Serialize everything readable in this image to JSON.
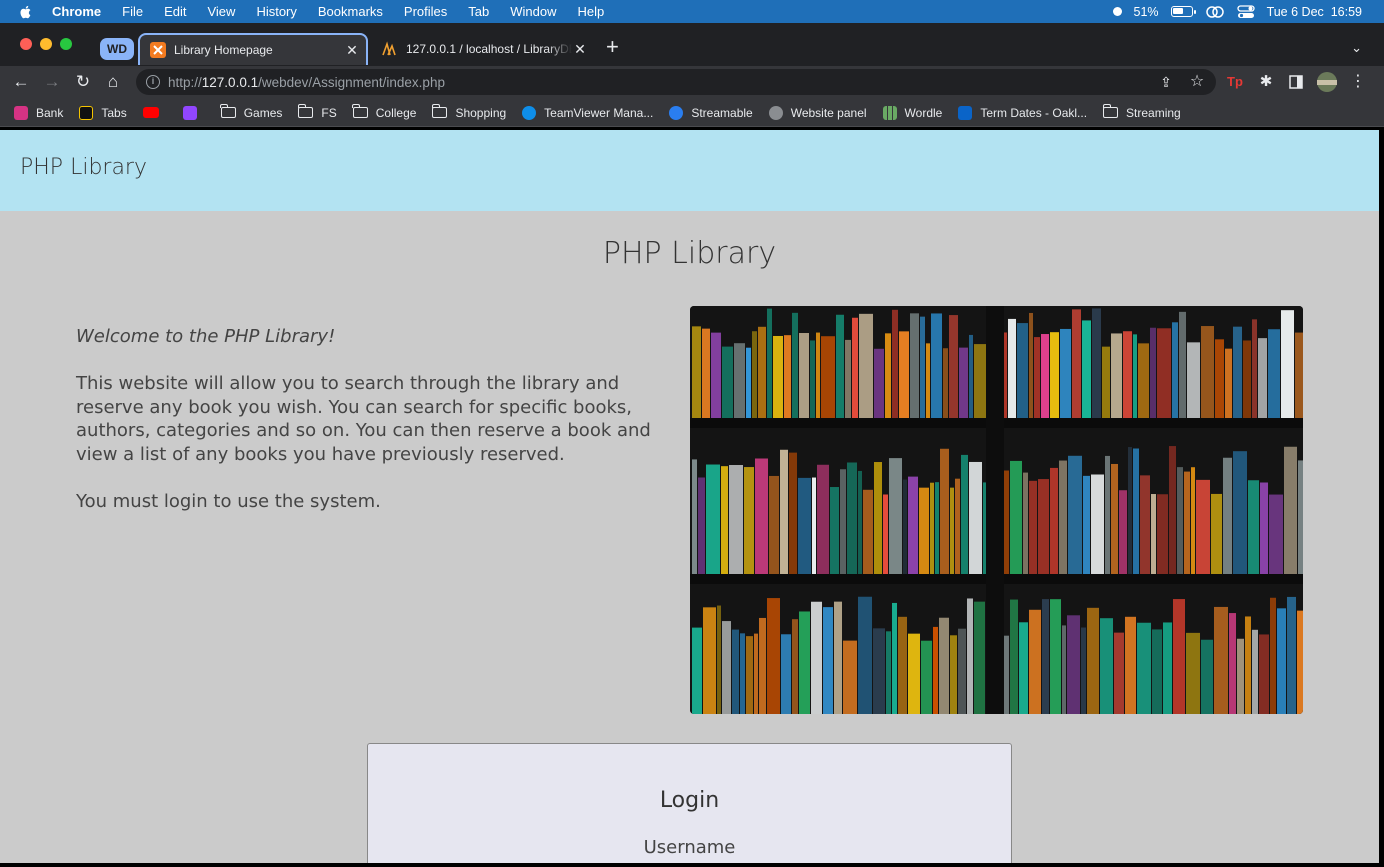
{
  "menubar": {
    "app": "Chrome",
    "items": [
      "File",
      "Edit",
      "View",
      "History",
      "Bookmarks",
      "Profiles",
      "Tab",
      "Window",
      "Help"
    ],
    "battery": "51%",
    "clock": "Tue 6 Dec  16:59"
  },
  "browser": {
    "group_chip": "WD",
    "tabs": [
      {
        "title": "Library Homepage",
        "active": true,
        "favicon": "xampp-icon"
      },
      {
        "title": "127.0.0.1 / localhost / LibraryDB",
        "active": false,
        "favicon": "phpmyadmin-icon"
      }
    ],
    "url_prefix": "http://",
    "url_host": "127.0.0.1",
    "url_path": "/webdev/Assignment/index.php"
  },
  "bookmarks": [
    {
      "label": "Bank",
      "icon": "bank-icon"
    },
    {
      "label": "Tabs",
      "icon": "g-icon"
    },
    {
      "label": "",
      "icon": "youtube-icon"
    },
    {
      "label": "",
      "icon": "twitch-icon"
    },
    {
      "label": "Games",
      "icon": "folder-icon"
    },
    {
      "label": "FS",
      "icon": "folder-icon"
    },
    {
      "label": "College",
      "icon": "folder-icon"
    },
    {
      "label": "Shopping",
      "icon": "folder-icon"
    },
    {
      "label": "TeamViewer Mana...",
      "icon": "teamviewer-icon"
    },
    {
      "label": "Streamable",
      "icon": "streamable-icon"
    },
    {
      "label": "Website panel",
      "icon": "globe-icon"
    },
    {
      "label": "Wordle",
      "icon": "wordle-icon"
    },
    {
      "label": "Term Dates - Oakl...",
      "icon": "outlook-icon"
    },
    {
      "label": "Streaming",
      "icon": "folder-icon"
    }
  ],
  "site": {
    "brand": "PHP Library",
    "title": "PHP Library",
    "welcome": "Welcome to the PHP Library!",
    "description": "This website will allow you to search through the library and reserve any book you wish. You can search for specific books, authors, categories and so on. You can then reserve a book and view a list of any books you have previously reserved.",
    "login_note": "You must login to use the system.",
    "login": {
      "heading": "Login",
      "username_label": "Username"
    }
  },
  "colors": {
    "menubar": "#1f6fb8",
    "site_header": "#b3e3f2",
    "page_background": "#cbcbcb",
    "login_card": "#e6e6f0"
  }
}
